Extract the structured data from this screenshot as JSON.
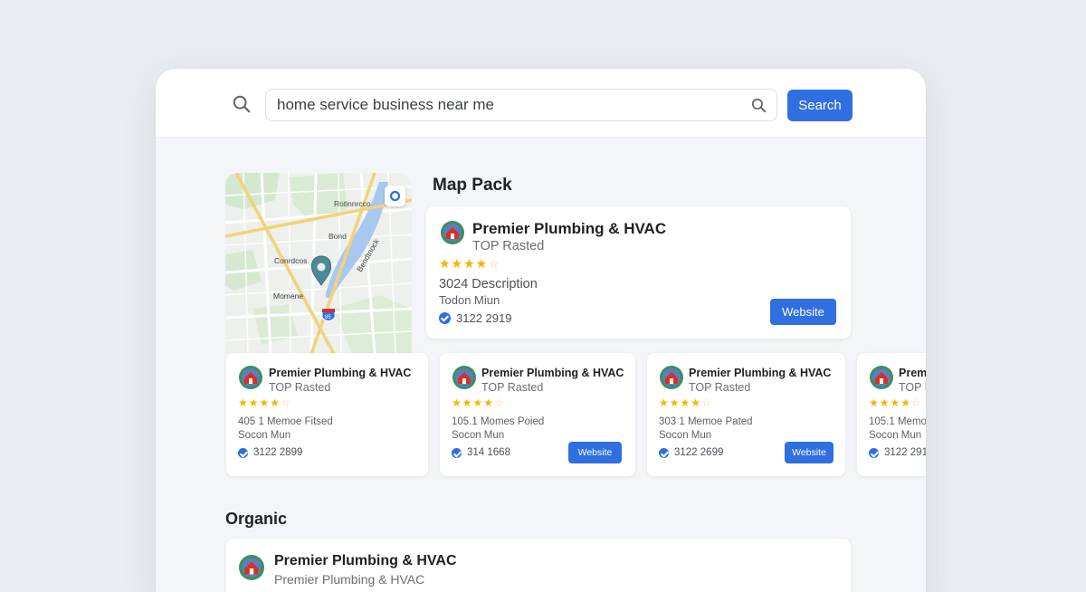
{
  "search": {
    "query": "home service business near me",
    "button_label": "Search"
  },
  "map": {
    "labels": [
      "Rotinnrcco",
      "Bond",
      "Conrdcos",
      "Momene",
      "Bendtnock"
    ],
    "highway_shield": "85"
  },
  "map_pack": {
    "title": "Map Pack",
    "featured": {
      "name": "Premier Plumbing & HVAC",
      "subtitle": "TOP Rasted",
      "rating": 4.5,
      "stars_filled": "★★★★",
      "stars_empty": "☆",
      "description": "3024 Description",
      "location": "Todon Miun",
      "phone": "3122 2919",
      "website_label": "Website"
    },
    "listings": [
      {
        "name": "Premier Plumbing & HVAC",
        "subtitle": "TOP Rasted",
        "stars_filled": "★★★★",
        "stars_empty": "☆",
        "address": "405 1 Memoe Fitsed",
        "location": "Socon Mun",
        "phone": "3122 2899",
        "website_label": ""
      },
      {
        "name": "Premier Plumbing & HVAC",
        "subtitle": "TOP Rasted",
        "stars_filled": "★★★★",
        "stars_empty": "☆",
        "address": "105.1 Momes Poied",
        "location": "Socon Mun",
        "phone": "314 1668",
        "website_label": "Website"
      },
      {
        "name": "Premier Plumbing & HVAC",
        "subtitle": "TOP Rasted",
        "stars_filled": "★★★★",
        "stars_empty": "☆",
        "address": "303 1 Memoe Pated",
        "location": "Socon Mun",
        "phone": "3122 2699",
        "website_label": "Website"
      },
      {
        "name": "Prem",
        "subtitle": "TOP R",
        "stars_filled": "★★★★",
        "stars_empty": "☆",
        "address": "105.1 Memo",
        "location": "Socon Mun",
        "phone": "3122 291",
        "website_label": ""
      }
    ]
  },
  "organic": {
    "title": "Organic",
    "result": {
      "name": "Premier Plumbing & HVAC",
      "subtitle": "Premier Plumbing & HVAC"
    }
  },
  "colors": {
    "accent": "#2f6fe0",
    "star": "#f4b400",
    "logo_red": "#d93025",
    "logo_green": "#3c8f5a"
  }
}
